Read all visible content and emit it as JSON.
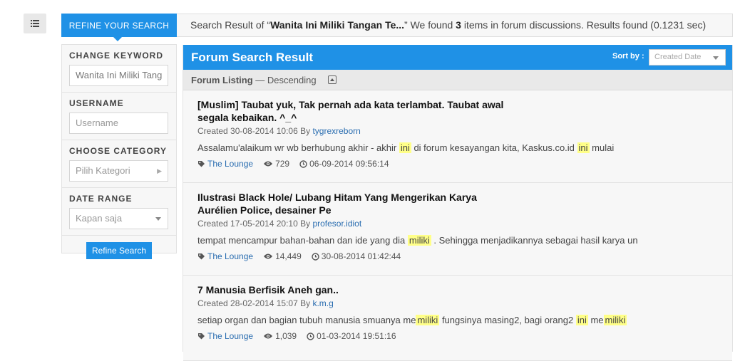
{
  "topbar": {
    "refine_tab": "REFINE YOUR SEARCH",
    "summary_prefix": "Search Result of “",
    "query": "Wanita Ini Miliki Tangan Te...",
    "summary_mid": "” We found ",
    "count": "3",
    "summary_suffix": " items in forum discussions. Results found (0.1231 sec)"
  },
  "sidebar": {
    "keyword_label": "CHANGE KEYWORD",
    "keyword_value": "Wanita Ini Miliki Tang",
    "username_label": "USERNAME",
    "username_placeholder": "Username",
    "category_label": "CHOOSE CATEGORY",
    "category_placeholder": "Pilih Kategori",
    "date_label": "DATE RANGE",
    "date_value": "Kapan saja",
    "refine_button": "Refine Search"
  },
  "main": {
    "title": "Forum Search Result",
    "sort_label": "Sort by :",
    "sort_value": "Created Date",
    "listing_label": "Forum Listing",
    "listing_order": " — Descending"
  },
  "results": [
    {
      "title_line1": "[Muslim] Taubat yuk, Tak pernah ada kata terlambat. Taubat awal",
      "title_line2": "segala kebaikan. ^_^",
      "created": "Created 30-08-2014 10:06 By ",
      "author": "tygrexreborn",
      "snippet": [
        {
          "text": "Assalamu'alaikum wr wb berhubung akhir - akhir ",
          "hl": false
        },
        {
          "text": "ini",
          "hl": true
        },
        {
          "text": " di forum kesayangan kita, Kaskus.co.id ",
          "hl": false
        },
        {
          "text": "ini",
          "hl": true
        },
        {
          "text": " mulai",
          "hl": false
        }
      ],
      "category": "The Lounge",
      "views": "729",
      "last_post": "06-09-2014 09:56:14"
    },
    {
      "title_line1": "Ilustrasi Black Hole/ Lubang Hitam Yang Mengerikan Karya",
      "title_line2": "Aurélien Police, desainer Pe",
      "created": "Created 17-05-2014 20:10 By ",
      "author": "profesor.idiot",
      "snippet": [
        {
          "text": "tempat mencampur bahan-bahan dan ide yang dia ",
          "hl": false
        },
        {
          "text": "miliki",
          "hl": true
        },
        {
          "text": " . Sehingga menjadikannya sebagai hasil karya un",
          "hl": false
        }
      ],
      "category": "The Lounge",
      "views": "14,449",
      "last_post": "30-08-2014 01:42:44"
    },
    {
      "title_line1": "7 Manusia Berfisik Aneh gan..",
      "title_line2": "",
      "created": "Created 28-02-2014 15:07 By ",
      "author": "k.m.g",
      "snippet": [
        {
          "text": "setiap organ dan bagian tubuh manusia smuanya me",
          "hl": false
        },
        {
          "text": "miliki",
          "hl": true
        },
        {
          "text": " fungsinya masing2, bagi orang2 ",
          "hl": false
        },
        {
          "text": "ini",
          "hl": true
        },
        {
          "text": " me",
          "hl": false
        },
        {
          "text": "miliki",
          "hl": true
        }
      ],
      "category": "The Lounge",
      "views": "1,039",
      "last_post": "01-03-2014 19:51:16"
    }
  ]
}
